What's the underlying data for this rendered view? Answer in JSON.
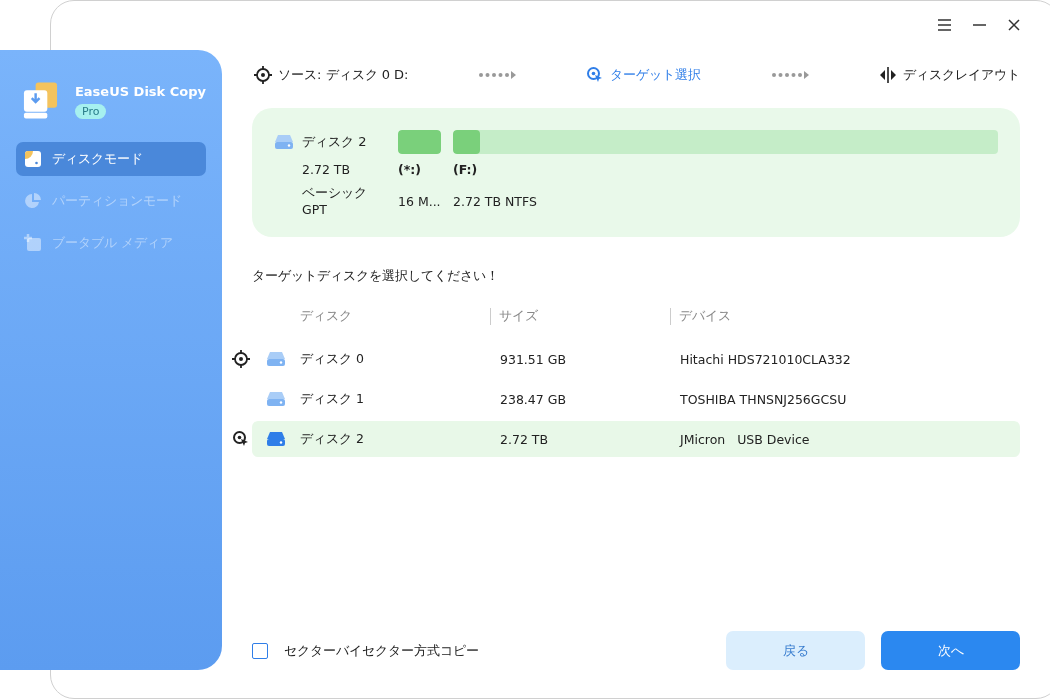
{
  "app": {
    "name": "EaseUS Disk Copy",
    "edition": "Pro"
  },
  "window_controls": [
    {
      "kind": "menu"
    },
    {
      "kind": "minimize"
    },
    {
      "kind": "close"
    }
  ],
  "sidebar": {
    "items": [
      {
        "label": "ディスクモード",
        "kind": "disk",
        "selected": true,
        "disabled": false
      },
      {
        "label": "パーティションモード",
        "kind": "partition",
        "selected": false,
        "disabled": true
      },
      {
        "label": "ブータブル メディア",
        "kind": "boot",
        "selected": false,
        "disabled": true
      }
    ]
  },
  "steps": [
    {
      "label": "ソース: ディスク 0 D:",
      "kind": "source",
      "selected": false
    },
    {
      "label": "ターゲット選択",
      "kind": "target",
      "selected": true
    },
    {
      "label": "ディスクレイアウト",
      "kind": "layout",
      "selected": false
    }
  ],
  "disk_card": {
    "name": "ディスク 2",
    "size": "2.72 TB",
    "type": "ベーシック GPT",
    "partitions": [
      {
        "letter": "(*:)",
        "info": "16 M...",
        "level": 1
      },
      {
        "letter": "(F:)",
        "info": "2.72 TB NTFS",
        "level": 0.05
      }
    ]
  },
  "prompt": "ターゲットディスクを選択してください！",
  "table": {
    "columns": [
      "ディスク",
      "サイズ",
      "デバイス"
    ],
    "rows": [
      {
        "kind": "source",
        "disk": "ディスク 0",
        "size": "931.51 GB",
        "device": "Hitachi HDS721010CLA332",
        "selected": false
      },
      {
        "kind": "plain",
        "disk": "ディスク 1",
        "size": "238.47 GB",
        "device": "TOSHIBA THNSNJ256GCSU",
        "selected": false
      },
      {
        "kind": "target",
        "disk": "ディスク 2",
        "size": "2.72 TB",
        "device": "JMicron   USB Device",
        "selected": true
      }
    ]
  },
  "sector_copy": {
    "label": "セクターバイセクター方式コピー",
    "checked": false
  },
  "buttons": [
    {
      "label": "戻る",
      "kind": "secondary"
    },
    {
      "label": "次へ",
      "kind": "primary"
    }
  ]
}
